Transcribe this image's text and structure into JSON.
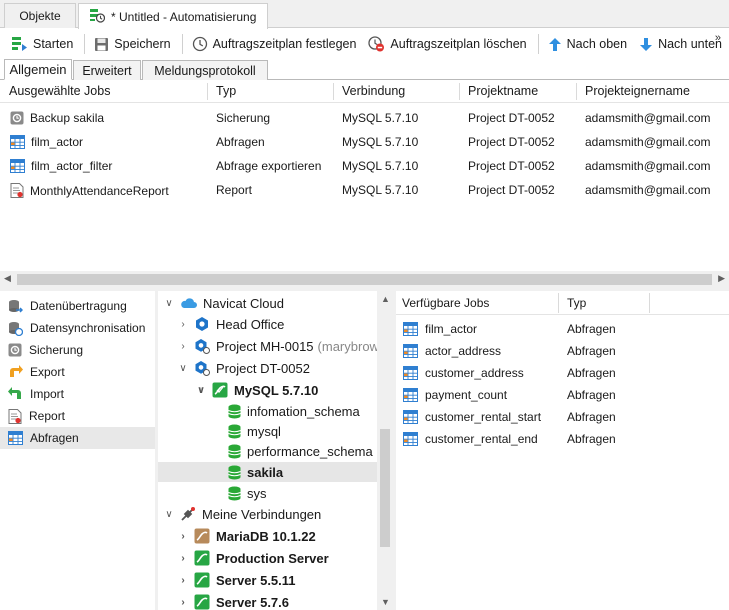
{
  "tabs": [
    {
      "label": "Objekte"
    },
    {
      "label": "* Untitled - Automatisierung"
    }
  ],
  "toolbar": {
    "start_label": "Starten",
    "save_label": "Speichern",
    "set_schedule_label": "Auftragszeitplan festlegen",
    "delete_schedule_label": "Auftragszeitplan löschen",
    "move_up_label": "Nach oben",
    "move_down_label": "Nach unten",
    "more_label": "»"
  },
  "subtabs": [
    {
      "label": "Allgemein"
    },
    {
      "label": "Erweitert"
    },
    {
      "label": "Meldungsprotokoll"
    }
  ],
  "jobs_table": {
    "headers": [
      "Ausgewählte Jobs",
      "Typ",
      "Verbindung",
      "Projektname",
      "Projekteignername"
    ],
    "rows": [
      {
        "icon": "backup-icon",
        "name": "Backup sakila",
        "type": "Sicherung",
        "connection": "MySQL 5.7.10",
        "project": "Project DT-0052",
        "owner": "adamsmith@gmail.com"
      },
      {
        "icon": "query-icon",
        "name": "film_actor",
        "type": "Abfragen",
        "connection": "MySQL 5.7.10",
        "project": "Project DT-0052",
        "owner": "adamsmith@gmail.com"
      },
      {
        "icon": "query-icon",
        "name": "film_actor_filter",
        "type": "Abfrage exportieren",
        "connection": "MySQL 5.7.10",
        "project": "Project DT-0052",
        "owner": "adamsmith@gmail.com"
      },
      {
        "icon": "report-icon",
        "name": "MonthlyAttendanceReport",
        "type": "Report",
        "connection": "MySQL 5.7.10",
        "project": "Project DT-0052",
        "owner": "adamsmith@gmail.com"
      }
    ]
  },
  "left_nav": {
    "items": [
      {
        "label": "Datenübertragung",
        "icon": "data-transfer-icon"
      },
      {
        "label": "Datensynchronisation",
        "icon": "data-sync-icon"
      },
      {
        "label": "Sicherung",
        "icon": "backup-icon"
      },
      {
        "label": "Export",
        "icon": "export-icon"
      },
      {
        "label": "Import",
        "icon": "import-icon"
      },
      {
        "label": "Report",
        "icon": "report-icon"
      },
      {
        "label": "Abfragen",
        "icon": "query-icon"
      }
    ],
    "selected": "Abfragen"
  },
  "tree": {
    "cloud_label": "Navicat Cloud",
    "head_office": "Head Office",
    "project_mh": "Project MH-0015",
    "project_mh_owner": "(marybrown",
    "project_dt": "Project DT-0052",
    "mysql_conn": "MySQL 5.7.10",
    "db1": "infomation_schema",
    "db2": "mysql",
    "db3": "performance_schema",
    "db4": "sakila",
    "db5": "sys",
    "my_connections": "Meine Verbindungen",
    "conn1": "MariaDB 10.1.22",
    "conn2": "Production Server",
    "conn3": "Server 5.5.11",
    "conn4": "Server 5.7.6"
  },
  "available_jobs": {
    "headers": [
      "Verfügbare Jobs",
      "Typ"
    ],
    "rows": [
      {
        "name": "film_actor",
        "type": "Abfragen"
      },
      {
        "name": "actor_address",
        "type": "Abfragen"
      },
      {
        "name": "customer_address",
        "type": "Abfragen"
      },
      {
        "name": "payment_count",
        "type": "Abfragen"
      },
      {
        "name": "customer_rental_start",
        "type": "Abfragen"
      },
      {
        "name": "customer_rental_end",
        "type": "Abfragen"
      }
    ]
  },
  "colors": {
    "accent_blue": "#2f7fd1",
    "mysql_green": "#27a644",
    "db_green": "#2aa836",
    "selection": "#e6e6e6"
  }
}
